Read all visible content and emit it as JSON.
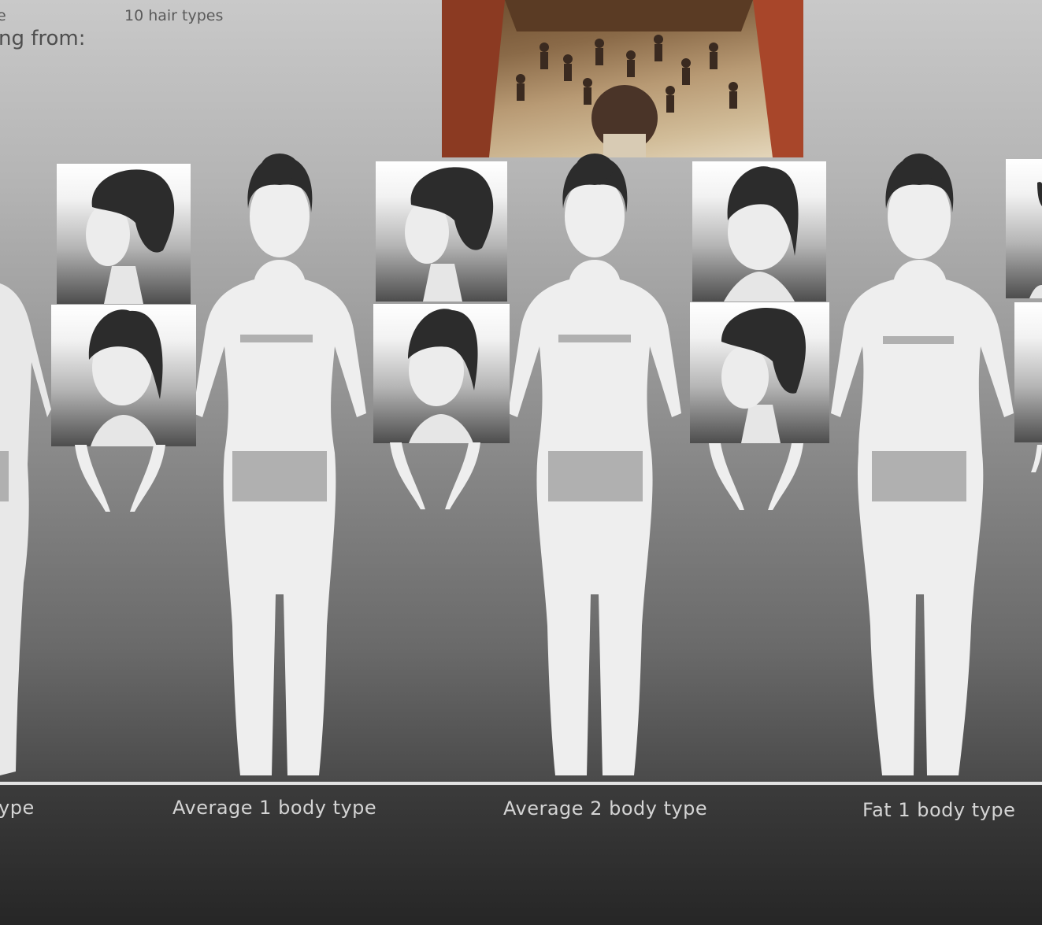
{
  "header": {
    "hair_types_label": "10 hair types",
    "partial_left_top": "e",
    "partial_left_line": "ng from:"
  },
  "captions": {
    "partial_left": "ype",
    "average_1": "Average 1 body type",
    "average_2": "Average 2 body type",
    "fat_1": "Fat 1 body type"
  },
  "colors": {
    "skin": "#eeeeee",
    "hair": "#2c2c2c",
    "censor_bar": "#b0b0b0",
    "caption_text": "#d4d4d4"
  },
  "reference_image": {
    "subject": "anime-crowd-scene-icon"
  }
}
